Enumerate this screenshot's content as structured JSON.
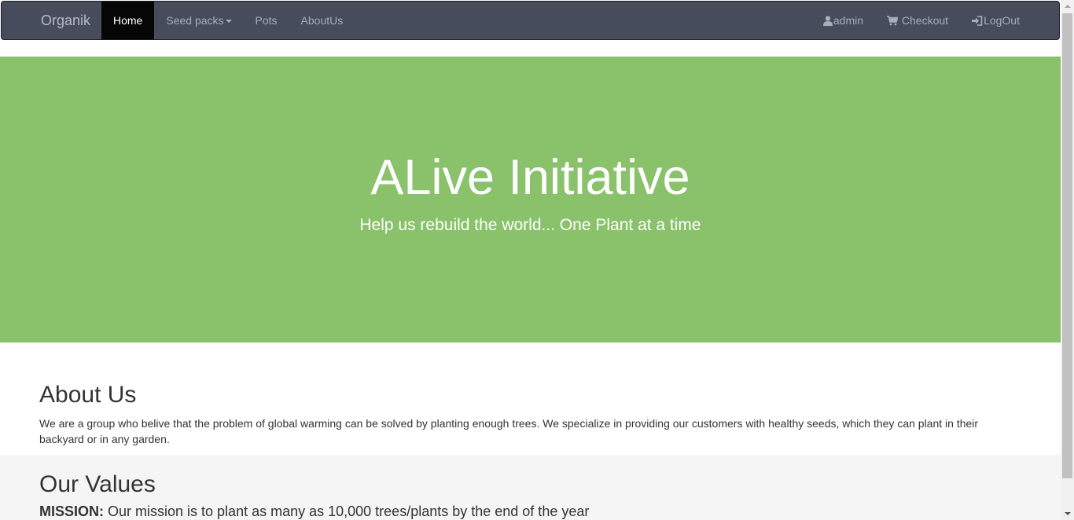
{
  "navbar": {
    "brand": "Organik",
    "left_items": [
      {
        "label": "Home",
        "active": true
      },
      {
        "label": "Seed packs",
        "dropdown": true
      },
      {
        "label": "Pots"
      },
      {
        "label": "AboutUs"
      }
    ],
    "right_items": [
      {
        "label": "admin",
        "icon": "user-icon"
      },
      {
        "label": "Checkout",
        "icon": "cart-icon"
      },
      {
        "label": "LogOut",
        "icon": "login-icon"
      }
    ]
  },
  "hero": {
    "title": "ALive Initiative",
    "subtitle": "Help us rebuild the world... One Plant at a time",
    "background": "#89c26a"
  },
  "about": {
    "heading": "About Us",
    "text": "We are a group who belive that the problem of global warming can be solved by planting enough trees. We specialize in providing our customers with healthy seeds, which they can plant in their backyard or in any garden."
  },
  "values": {
    "heading": "Our Values",
    "mission_label": "MISSION:",
    "mission_text": " Our mission is to plant as many as 10,000 trees/plants by the end of the year"
  },
  "colors": {
    "navbar": "#474c5d",
    "accent_green": "#89c26a",
    "active_tab": "#060606"
  }
}
